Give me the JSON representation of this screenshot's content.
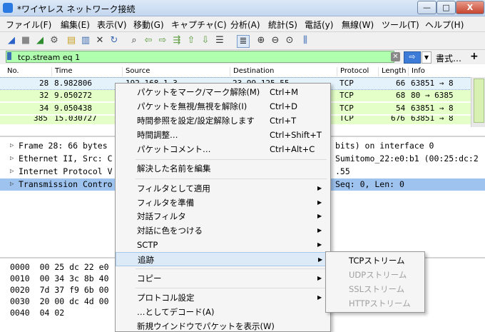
{
  "window": {
    "title": "*ワイヤレス ネットワーク接続",
    "min": "—",
    "max": "□",
    "close": "X"
  },
  "menubar": [
    "ファイル(F)",
    "編集(E)",
    "表示(V)",
    "移動(G)",
    "キャプチャ(C)",
    "分析(A)",
    "統計(S)",
    "電話(y)",
    "無線(W)",
    "ツール(T)",
    "ヘルプ(H)"
  ],
  "filter": {
    "value": "tcp.stream eq 1",
    "expressions_label": "書式…",
    "add_label": "+"
  },
  "packet_list": {
    "columns": [
      "No.",
      "Time",
      "Source",
      "Destination",
      "Protocol",
      "Length",
      "Info"
    ],
    "rows": [
      {
        "no": "28",
        "time": "8.982806",
        "source": "192.168.1.3",
        "destination": "23.99.125.55",
        "protocol": "TCP",
        "length": "66",
        "info": "63851 → 8"
      },
      {
        "no": "32",
        "time": "9.050272",
        "source": "",
        "destination": "",
        "protocol": "TCP",
        "length": "68",
        "info": "80 → 6385"
      },
      {
        "no": "34",
        "time": "9.050438",
        "source": "",
        "destination": "",
        "protocol": "TCP",
        "length": "54",
        "info": "63851 → 8"
      },
      {
        "no": "385",
        "time": "15.030727",
        "source": "",
        "destination": "",
        "protocol": "TCP",
        "length": "676",
        "info": "63851 → 8"
      }
    ]
  },
  "details": [
    {
      "left": "Frame 28: 66 bytes",
      "right": "bits) on interface 0"
    },
    {
      "left": "Ethernet II, Src: C",
      "right": "Sumitomo_22:e0:b1 (00:25:dc:2"
    },
    {
      "left": "Internet Protocol V",
      "right": ".55"
    },
    {
      "left": "Transmission Contro",
      "right": "Seq: 0, Len: 0"
    }
  ],
  "bytes": [
    {
      "offset": "0000",
      "hex": "00 25 dc 22 e0"
    },
    {
      "offset": "0010",
      "hex": "00 34 3c 8b 40"
    },
    {
      "offset": "0020",
      "hex": "7d 37 f9 6b 00"
    },
    {
      "offset": "0030",
      "hex": "20 00 dc 4d 00"
    },
    {
      "offset": "0040",
      "hex": "04 02"
    }
  ],
  "context_menu": {
    "mark": {
      "label": "パケットをマーク/マーク解除(M)",
      "shortcut": "Ctrl+M"
    },
    "ignore": {
      "label": "パケットを無視/無視を解除(I)",
      "shortcut": "Ctrl+D"
    },
    "time_ref": {
      "label": "時間参照を設定/設定解除します",
      "shortcut": "Ctrl+T"
    },
    "time_shift": {
      "label": "時間調整…",
      "shortcut": "Ctrl+Shift+T"
    },
    "comment": {
      "label": "パケットコメント…",
      "shortcut": "Ctrl+Alt+C"
    },
    "resolved_name": {
      "label": "解決した名前を編集"
    },
    "apply_filter": {
      "label": "フィルタとして適用"
    },
    "prepare_filter": {
      "label": "フィルタを準備"
    },
    "conv_filter": {
      "label": "対話フィルタ"
    },
    "colorize": {
      "label": "対話に色をつける"
    },
    "sctp": {
      "label": "SCTP"
    },
    "follow": {
      "label": "追跡"
    },
    "copy": {
      "label": "コピー"
    },
    "protocol_prefs": {
      "label": "プロトコル設定"
    },
    "decode_as": {
      "label": "…としてデコード(A)"
    },
    "new_window": {
      "label": "新規ウインドウでパケットを表示(W)"
    }
  },
  "follow_submenu": [
    "TCPストリーム",
    "UDPストリーム",
    "SSLストリーム",
    "HTTPストリーム"
  ]
}
